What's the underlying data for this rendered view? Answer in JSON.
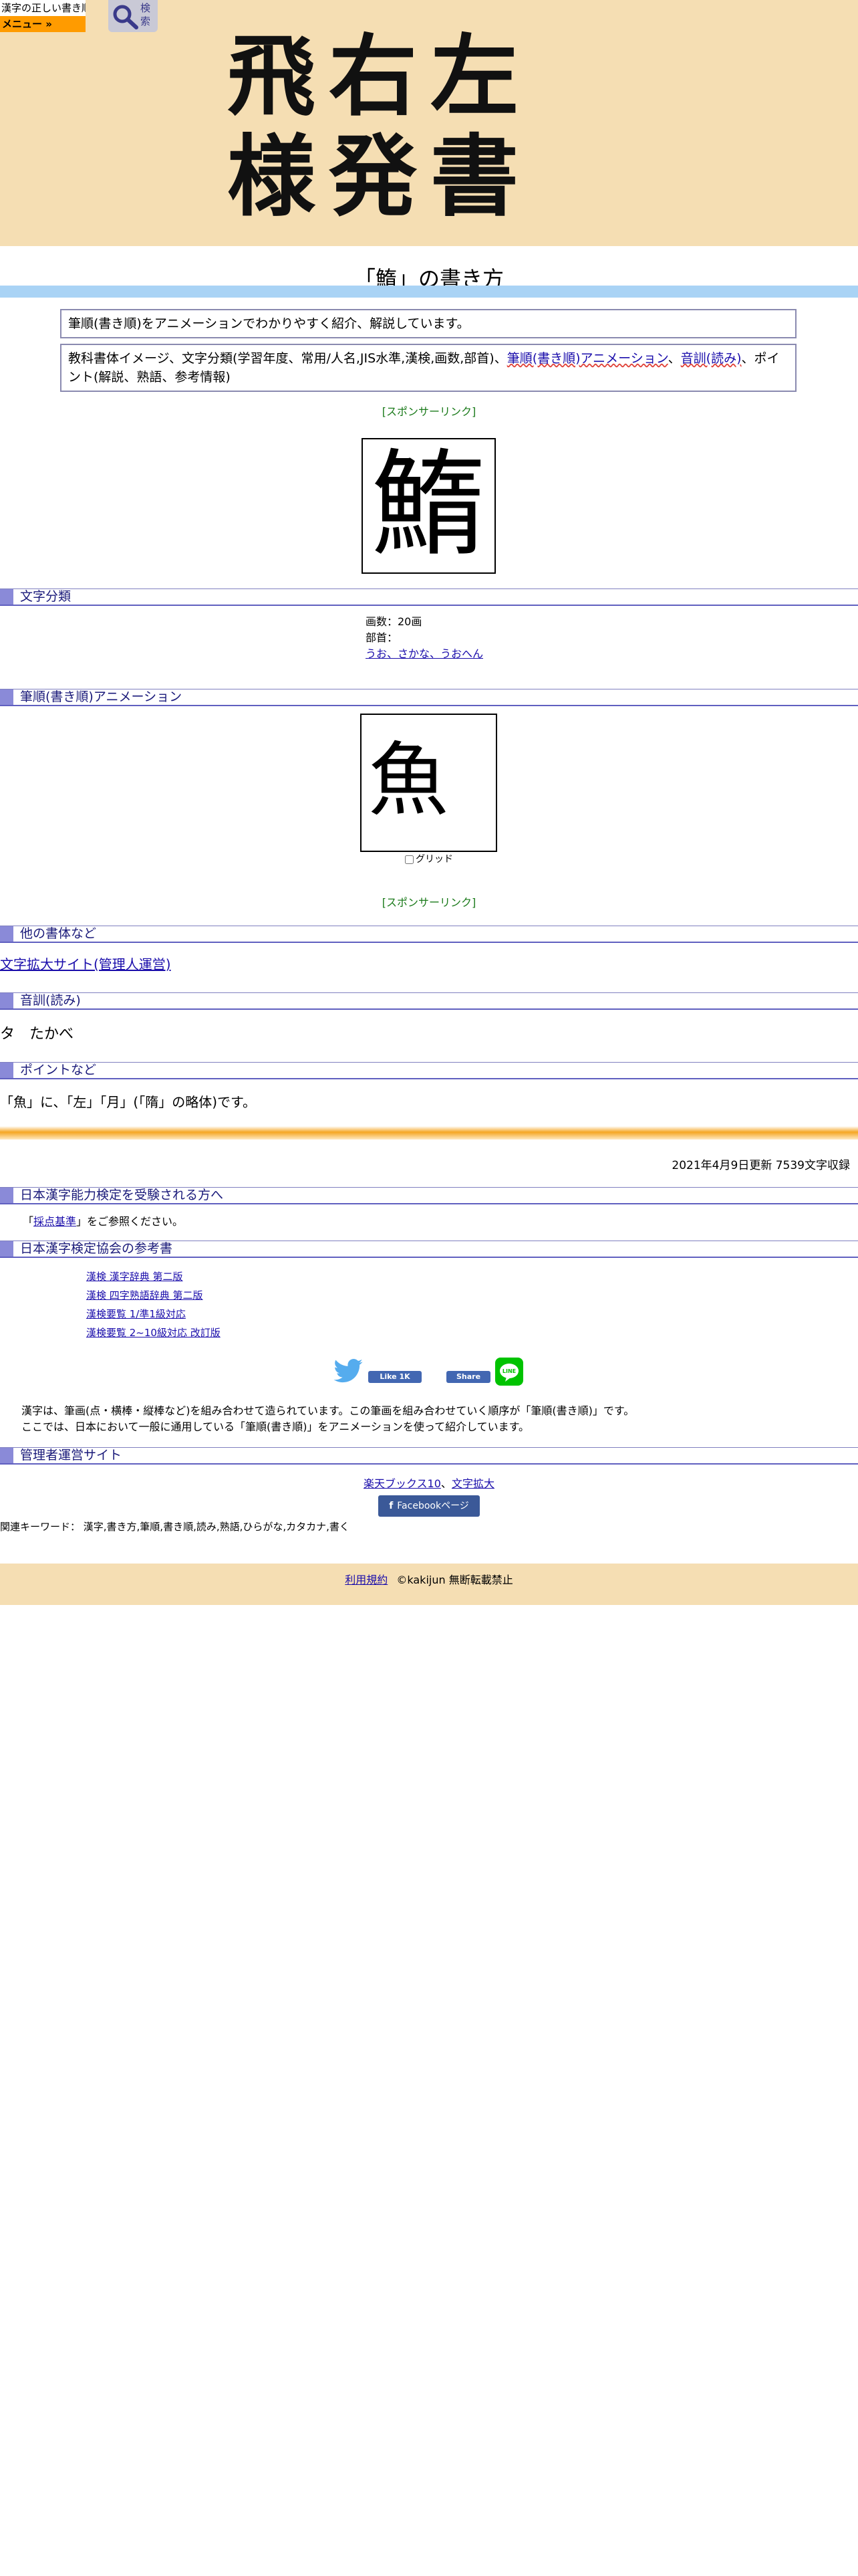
{
  "header": {
    "logo_text": "漢字の正しい書き順(筆順)",
    "menu_label": "メニュー »",
    "search_label": "検索",
    "banner_lines": [
      "飛右左",
      "様発書"
    ]
  },
  "page_title": "「鰖」の書き方",
  "intro_box": "筆順(書き順)をアニメーションでわかりやすく紹介、解説しています。",
  "contents_box": {
    "prefix": "教科書体イメージ、文字分類(学習年度、常用/人名,JIS水準,漢検,画数,部首)、",
    "link1": "筆順(書き順)アニメーション",
    "sep": "、",
    "link2": "音訓(読み)",
    "suffix": "、ポイント(解説、熟語、参考情報)"
  },
  "sponsor_label": "[スポンサーリンク]",
  "kanji": "鰖",
  "sections": {
    "classification": "文字分類",
    "animation": "筆順(書き順)アニメーション",
    "other_fonts": "他の書体など",
    "readings": "音訓(読み)",
    "points": "ポイントなど",
    "kentei_takers": "日本漢字能力検定を受験される方へ",
    "kentei_books": "日本漢字検定協会の参考書",
    "admin_sites": "管理者運営サイト"
  },
  "classification": {
    "strokes": "画数：20画",
    "radical_label": "部首：",
    "radical_link": "うお、さかな、うおへん"
  },
  "animation": {
    "current_stroke": "魚",
    "grid_label": "グリッド"
  },
  "other_fonts_link": "文字拡大サイト(管理人運営)",
  "readings": "タ　たかべ",
  "point_text": "「魚」に、「左」「月」(「隋」の略体)です。",
  "updated": "2021年4月9日更新 7539文字収録",
  "kentei_note": {
    "open": "「",
    "link": "採点基準",
    "close": "」をご参照ください。"
  },
  "books": [
    "漢検 漢字辞典 第二版",
    "漢検 四字熟語辞典 第二版",
    "漢検要覧 1/準1級対応",
    "漢検要覧 2~10級対応 改訂版"
  ],
  "social": {
    "fb_like": "Like 1K",
    "fb_share": "Share",
    "line_label": "LINE"
  },
  "description": [
    "漢字は、筆画(点・横棒・縦棒など)を組み合わせて造られています。この筆画を組み合わせていく順序が「筆順(書き順)」です。",
    "ここでは、日本において一般に通用している「筆順(書き順)」をアニメーションを使って紹介しています。"
  ],
  "admin_links": {
    "link1": "楽天ブックス10",
    "sep": "、",
    "link2": "文字拡大"
  },
  "facebook_page": "Facebookページ",
  "keywords": "関連キーワード： 漢字,書き方,筆順,書き順,読み,熟語,ひらがな,カタカナ,書く",
  "footer": {
    "terms": "利用規約",
    "copyright": "©kakijun 無断転載禁止"
  },
  "colors": {
    "header_bg": "#f5deb3",
    "menu_orange": "#ff9b00",
    "title_band": "#a9d3f5",
    "section_mark": "#8a8ad8",
    "link": "#1a0dab",
    "sponsor_green": "#1a7a1a"
  }
}
